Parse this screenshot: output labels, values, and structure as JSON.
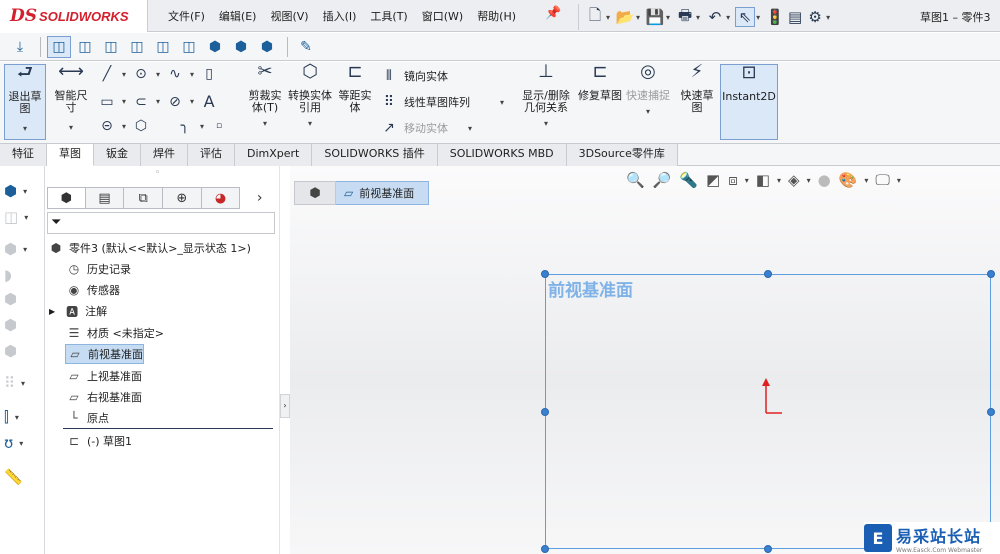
{
  "app": {
    "logo_ds": "DS",
    "logo_name": "SOLIDWORKS",
    "window_title": "草图1 – 零件3"
  },
  "menu": [
    "文件(F)",
    "编辑(E)",
    "视图(V)",
    "插入(I)",
    "工具(T)",
    "窗口(W)",
    "帮助(H)"
  ],
  "ribbon": {
    "exit_sketch": "退出草图",
    "smart_dim": "智能尺寸",
    "trim": "剪裁实体(T)",
    "convert": "转换实体引用",
    "offset": "等距实体",
    "mirror": "镜向实体",
    "linear_pattern": "线性草图阵列",
    "move": "移动实体",
    "relations": "显示/删除几何关系",
    "repair": "修复草图",
    "quick_snap": "快速捕捉",
    "rapid_sketch": "快速草图",
    "instant2d": "Instant2D"
  },
  "tabs": [
    "特征",
    "草图",
    "钣金",
    "焊件",
    "评估",
    "DimXpert",
    "SOLIDWORKS 插件",
    "SOLIDWORKS MBD",
    "3DSource零件库"
  ],
  "active_tab": "草图",
  "tree": {
    "root": "零件3 (默认<<默认>_显示状态 1>)",
    "history": "历史记录",
    "sensors": "传感器",
    "annotations": "注解",
    "material": "材质 <未指定>",
    "front_plane": "前视基准面",
    "top_plane": "上视基准面",
    "right_plane": "右视基准面",
    "origin": "原点",
    "sketch": "(-) 草图1"
  },
  "canvas": {
    "breadcrumb": "前视基准面",
    "plane_label": "前视基准面"
  },
  "watermark": {
    "title": "易采站长站",
    "subtitle": "Www.Easck.Com Webmaster"
  },
  "colors": {
    "accent": "#d3202d",
    "plane": "#5d9de0",
    "selection": "#c6dcf3"
  }
}
